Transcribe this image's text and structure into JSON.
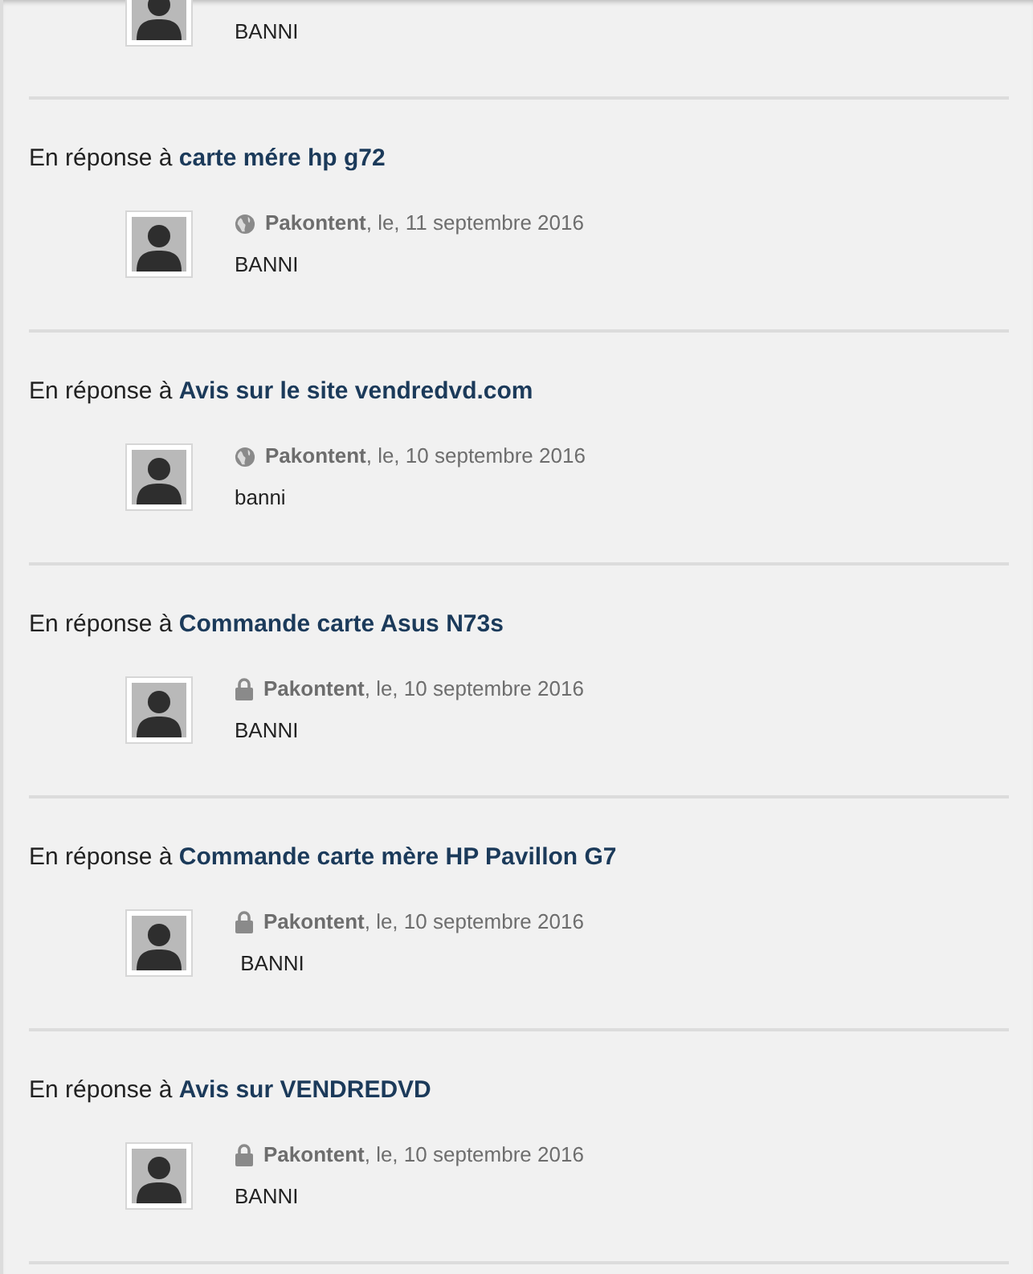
{
  "top_reply": {
    "body": "BANNI"
  },
  "replies": [
    {
      "prefix": "En réponse à",
      "topic": "carte mére hp g72",
      "kind": "public",
      "author": "Pakontent",
      "date": ", le, 11 septembre 2016",
      "body": "BANNI"
    },
    {
      "prefix": "En réponse à",
      "topic": "Avis sur le site vendredvd.com",
      "kind": "public",
      "author": "Pakontent",
      "date": ", le, 10 septembre 2016",
      "body": "banni"
    },
    {
      "prefix": "En réponse à",
      "topic": "Commande carte Asus N73s",
      "kind": "private",
      "author": "Pakontent",
      "date": ", le, 10 septembre 2016",
      "body": "BANNI"
    },
    {
      "prefix": "En réponse à",
      "topic": "Commande carte mère HP Pavillon G7",
      "kind": "private",
      "author": "Pakontent",
      "date": ", le, 10 septembre 2016",
      "body": " BANNI"
    },
    {
      "prefix": "En réponse à",
      "topic": "Avis sur VENDREDVD",
      "kind": "private",
      "author": "Pakontent",
      "date": ", le, 10 septembre 2016",
      "body": "BANNI"
    }
  ]
}
